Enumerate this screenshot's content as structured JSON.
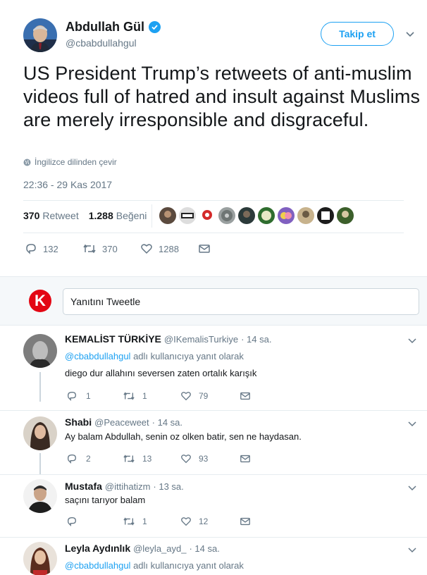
{
  "tweet": {
    "author_name": "Abdullah Gül",
    "author_handle": "@cbabdullahgul",
    "follow_label": "Takip et",
    "text": "US President Trump’s retweets of anti-muslim videos full of hatred and insult against Muslims are merely irresponsible and disgraceful.",
    "translate_label": "İngilizce dilinden çevir",
    "timestamp": "22:36 - 29 Kas 2017",
    "retweet_count": "370",
    "retweet_label": "Retweet",
    "like_count": "1.288",
    "like_label": "Beğeni",
    "actions": {
      "replies": "132",
      "retweets": "370",
      "likes": "1288"
    }
  },
  "compose": {
    "logo_letter": "K",
    "placeholder": "Yanıtını Tweetle"
  },
  "replies": [
    {
      "name": "KEMALİST TÜRKİYE",
      "handle": "@IKemalisTurkiye",
      "time": "· 14 sa.",
      "replying_handle": "@cbabdullahgul",
      "replying_suffix": "adlı kullanıcıya yanıt olarak",
      "text": "diego dur allahını seversen zaten ortalık karışık",
      "replies": "1",
      "retweets": "1",
      "likes": "79"
    },
    {
      "name": "Shabi",
      "handle": "@Peaceweet",
      "time": "· 14 sa.",
      "text": "Ay balam Abdullah, senin oz olken batir, sen ne haydasan.",
      "replies": "2",
      "retweets": "13",
      "likes": "93"
    },
    {
      "name": "Mustafa",
      "handle": "@ittihatizm",
      "time": "· 13 sa.",
      "text": "saçını tarıyor balam",
      "replies": "",
      "retweets": "1",
      "likes": "12"
    },
    {
      "name": "Leyla Aydınlık",
      "handle": "@leyla_ayd_",
      "time": "· 14 sa.",
      "replying_handle": "@cbabdullahgul",
      "replying_suffix": "adlı kullanıcıya yanıt olarak"
    }
  ],
  "colors": {
    "accent": "#1da1f2",
    "muted": "#657786",
    "text": "#14171a",
    "logo_red": "#e30613"
  }
}
